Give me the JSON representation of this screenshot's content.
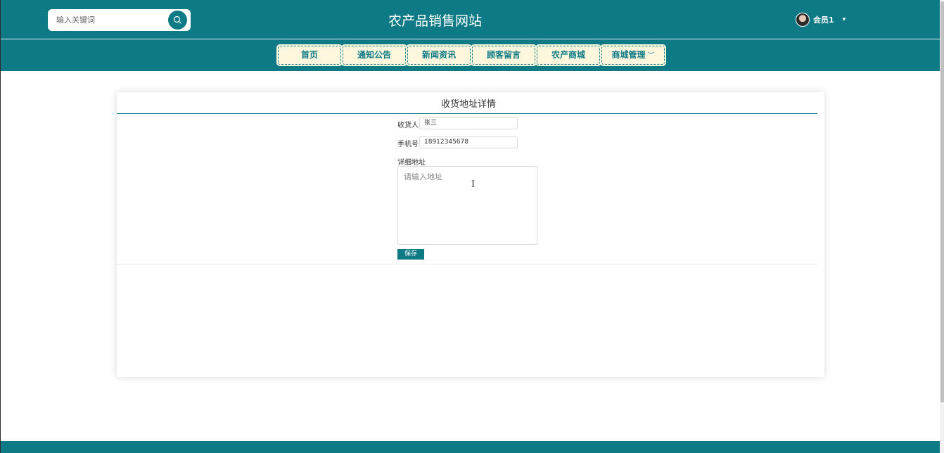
{
  "header": {
    "site_title": "农产品销售网站",
    "search_placeholder": "输入关键词",
    "user_name": "会员1",
    "user_caret": "▾"
  },
  "nav": {
    "items": [
      {
        "label": "首页"
      },
      {
        "label": "通知公告"
      },
      {
        "label": "新闻资讯"
      },
      {
        "label": "顾客留言"
      },
      {
        "label": "农产商城"
      },
      {
        "label": "商城管理",
        "chevron": "﹀"
      }
    ]
  },
  "form": {
    "title": "收货地址详情",
    "receiver_label": "收货人",
    "receiver_value": "张三",
    "phone_label": "手机号",
    "phone_value": "18912345678",
    "address_label": "详细地址",
    "address_placeholder": "请输入地址",
    "save_label": "保存"
  },
  "colors": {
    "brand": "#0d7a85",
    "nav_item_bg": "#fdf7dd"
  },
  "icons": {
    "search": "search-icon",
    "text_cursor": "Ⅰ"
  }
}
